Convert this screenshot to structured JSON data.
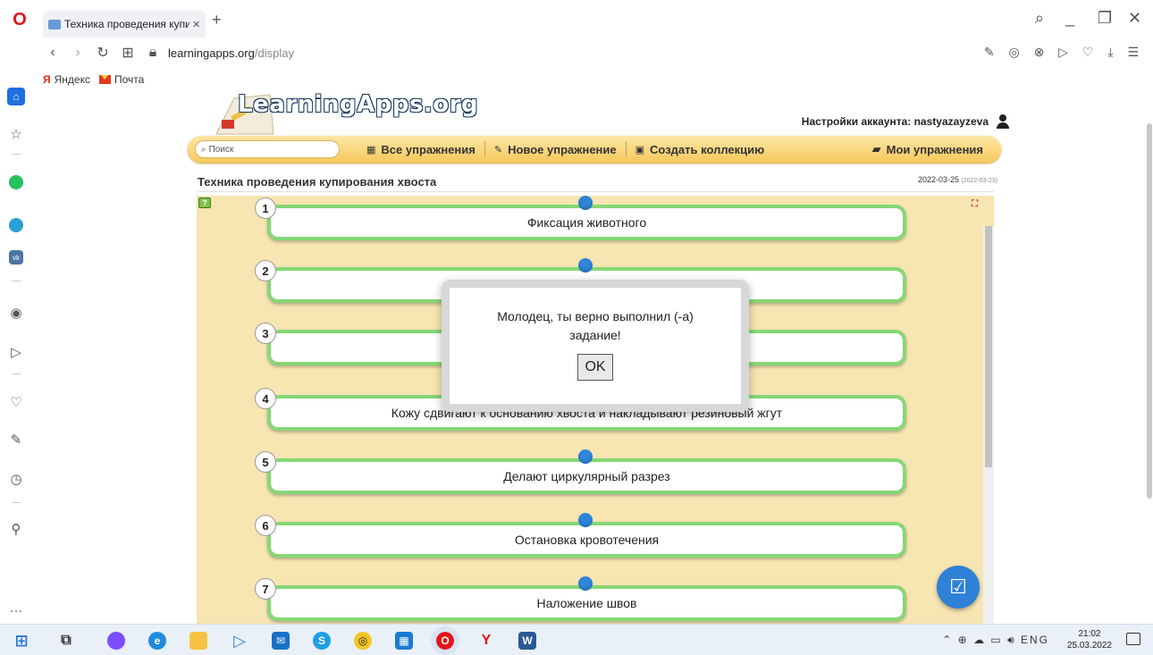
{
  "browser": {
    "tab_title": "Техника проведения купи",
    "url_domain": "learningapps.org",
    "url_path": "/display",
    "bookmarks": [
      "Яндекс",
      "Почта"
    ]
  },
  "site": {
    "logo_text": "LearningApps.org",
    "account_label": "Настройки аккаунта: nastyazayzeva",
    "search_placeholder": "Поиск",
    "menu": {
      "all": "Все упражнения",
      "new": "Новое упражнение",
      "collection": "Создать коллекцию",
      "mine": "Мои упражнения"
    }
  },
  "exercise": {
    "title": "Техника проведения купирования хвоста",
    "date": "2022-03-25",
    "date_small": "(2022-03-23)",
    "steps": [
      {
        "num": "1",
        "text": "Фиксация животного"
      },
      {
        "num": "2",
        "text": ""
      },
      {
        "num": "3",
        "text": ""
      },
      {
        "num": "4",
        "text": "Кожу сдвигают к основанию хвоста и накладывают резиновый жгут"
      },
      {
        "num": "5",
        "text": "Делают циркулярный разрез"
      },
      {
        "num": "6",
        "text": "Остановка кровотечения"
      },
      {
        "num": "7",
        "text": "Наложение швов"
      }
    ]
  },
  "dialog": {
    "message": "Молодец, ты верно выполнил (-а) задание!",
    "ok_label": "OK"
  },
  "taskbar": {
    "lang": "ENG",
    "time": "21:02",
    "date": "25.03.2022"
  },
  "colors": {
    "accent_green": "#86d775",
    "accent_blue": "#2f85d8",
    "menu_gold": "#f6c95b",
    "exercise_bg": "#f7e5b2"
  }
}
